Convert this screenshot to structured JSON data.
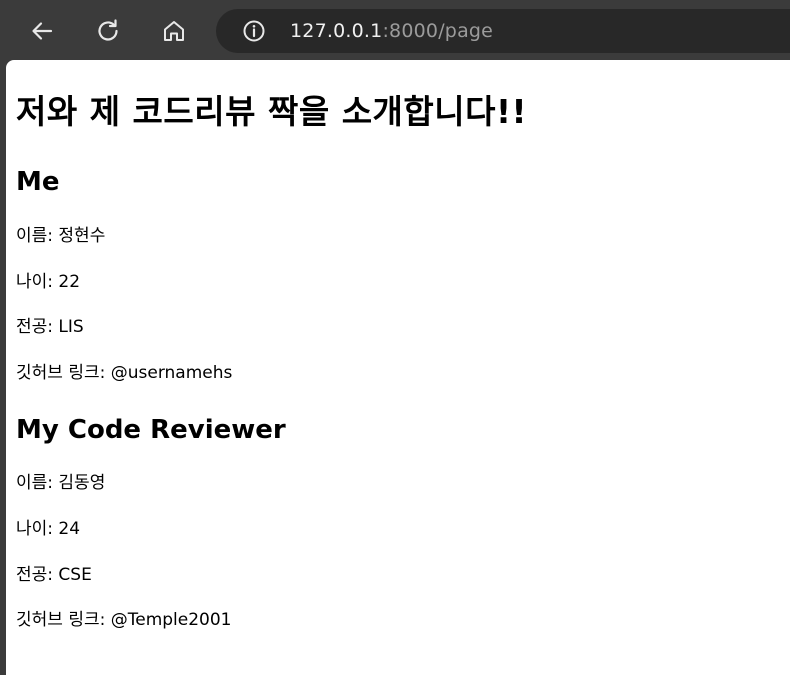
{
  "browser": {
    "url_host": "127.0.0.1",
    "url_rest": ":8000/page",
    "icons": {
      "back": "arrow-left-icon",
      "reload": "reload-icon",
      "home": "home-icon",
      "info": "info-icon"
    }
  },
  "page": {
    "title": "저와 제 코드리뷰 짝을 소개합니다!!",
    "me": {
      "heading": "Me",
      "name": "이름: 정현수",
      "age": "나이: 22",
      "major": "전공: LIS",
      "github": "깃허브 링크: @usernamehs"
    },
    "reviewer": {
      "heading": "My Code Reviewer",
      "name": "이름: 김동영",
      "age": "나이: 24",
      "major": "전공: CSE",
      "github": "깃허브 링크: @Temple2001"
    }
  }
}
